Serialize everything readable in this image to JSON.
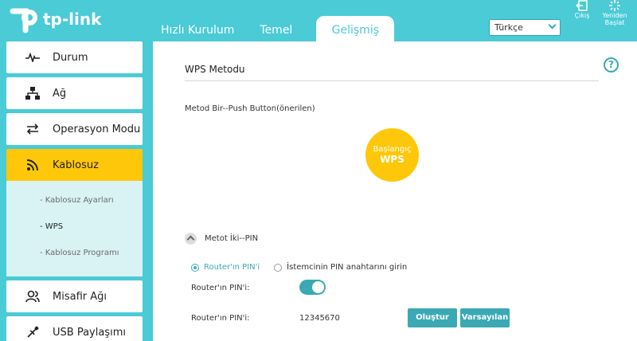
{
  "brand": {
    "name": "tp-link"
  },
  "tabs": [
    {
      "label": "Hızlı Kurulum"
    },
    {
      "label": "Temel"
    },
    {
      "label": "Gelişmiş"
    }
  ],
  "language": {
    "selected": "Türkçe"
  },
  "top_buttons": {
    "logout": "Çıkış",
    "reboot_line1": "Yeniden",
    "reboot_line2": "Başlat"
  },
  "sidebar": {
    "items": [
      {
        "label": "Durum",
        "icon": "pulse-icon"
      },
      {
        "label": "Ağ",
        "icon": "network-icon"
      },
      {
        "label": "Operasyon Modu",
        "icon": "mode-icon"
      },
      {
        "label": "Kablosuz",
        "icon": "wireless-icon"
      },
      {
        "label": "Misafir Ağı",
        "icon": "guest-icon"
      },
      {
        "label": "USB Paylaşımı",
        "icon": "usb-icon"
      }
    ],
    "sub_items": [
      {
        "label": "- Kablosuz Ayarları"
      },
      {
        "label": "- WPS"
      },
      {
        "label": "- Kablosuz Programı"
      }
    ]
  },
  "main": {
    "section_title": "WPS Metodu",
    "method1_label": "Metod Bir--Push Button(önerilen)",
    "wps_button": {
      "line1": "Başlangıç",
      "line2": "WPS"
    },
    "method2_label": "Metot İki--PIN",
    "radio_router_pin": "Router'ın PIN'i",
    "radio_client_pin": "İstemcinin PIN anahtarını girin",
    "router_pin_toggle_label": "Router'ın PIN'i:",
    "router_pin_value_label": "Router'ın PIN'i:",
    "pin_value": "12345670",
    "generate_button": "Oluştur",
    "default_button": "Varsayılan"
  },
  "colors": {
    "accent": "#4acbd6",
    "highlight": "#ffc709",
    "button": "#3aa9b4"
  }
}
